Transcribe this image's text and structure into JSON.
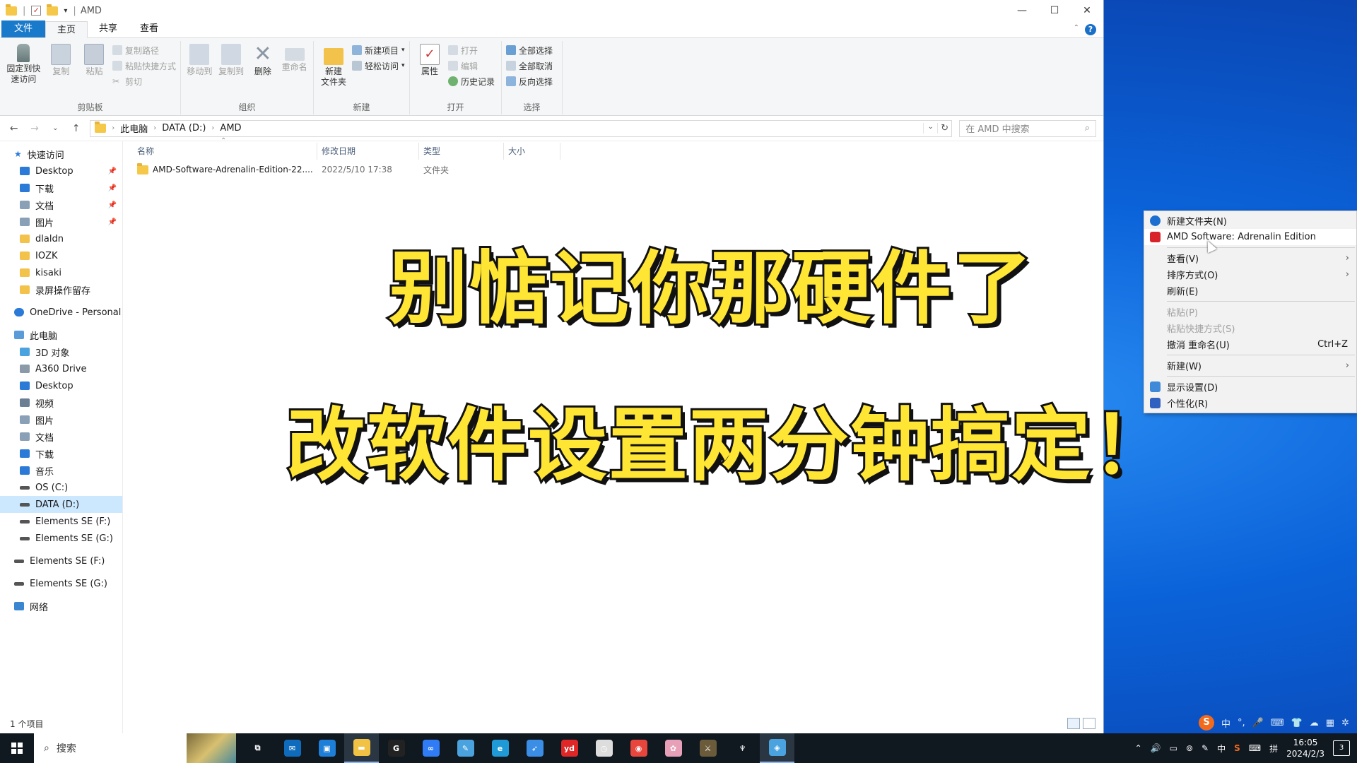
{
  "window": {
    "title": "AMD",
    "controls": {
      "minimize": "—",
      "maximize": "☐",
      "close": "✕"
    }
  },
  "tabs": [
    "文件",
    "主页",
    "共享",
    "查看"
  ],
  "ribbon": {
    "clipboard": {
      "label": "剪贴板",
      "pin": "固定到快\n速访问",
      "copy": "复制",
      "paste": "粘贴",
      "copy_path": "复制路径",
      "paste_shortcut": "粘贴快捷方式",
      "cut": "剪切"
    },
    "organize": {
      "label": "组织",
      "move_to": "移动到",
      "copy_to": "复制到",
      "delete": "删除",
      "rename": "重命名"
    },
    "new": {
      "label": "新建",
      "new_folder": "新建\n文件夹",
      "new_item": "新建项目",
      "easy_access": "轻松访问"
    },
    "open": {
      "label": "打开",
      "properties": "属性",
      "open": "打开",
      "edit": "编辑",
      "history": "历史记录"
    },
    "select": {
      "label": "选择",
      "select_all": "全部选择",
      "select_none": "全部取消",
      "invert": "反向选择"
    }
  },
  "address": {
    "crumbs": [
      "此电脑",
      "DATA (D:)",
      "AMD"
    ],
    "search_placeholder": "在 AMD 中搜索"
  },
  "nav": {
    "quick_access": "快速访问",
    "quick_items": [
      {
        "label": "Desktop",
        "pinned": true
      },
      {
        "label": "下载",
        "pinned": true
      },
      {
        "label": "文档",
        "pinned": true
      },
      {
        "label": "图片",
        "pinned": true
      },
      {
        "label": "dlaldn",
        "pinned": false
      },
      {
        "label": "IOZK",
        "pinned": false
      },
      {
        "label": "kisaki",
        "pinned": false
      },
      {
        "label": "录屏操作留存",
        "pinned": false
      }
    ],
    "onedrive": "OneDrive - Personal",
    "this_pc": "此电脑",
    "pc_items": [
      "3D 对象",
      "A360 Drive",
      "Desktop",
      "视频",
      "图片",
      "文档",
      "下载",
      "音乐",
      "OS (C:)",
      "DATA (D:)",
      "Elements SE (F:)",
      "Elements SE (G:)"
    ],
    "drive_f": "Elements SE (F:)",
    "drive_g": "Elements SE (G:)",
    "network": "网络"
  },
  "columns": [
    "名称",
    "修改日期",
    "类型",
    "大小"
  ],
  "files": [
    {
      "name": "AMD-Software-Adrenalin-Edition-22....",
      "date": "2022/5/10 17:38",
      "type": "文件夹",
      "size": ""
    }
  ],
  "status": {
    "count": "1 个项目"
  },
  "overlay": {
    "line1": "别惦记你那硬件了",
    "line2": "改软件设置两分钟搞定！"
  },
  "context_menu": [
    {
      "label": "新建文件夹(N)",
      "icon": "new-folder-icon",
      "disabled": false
    },
    {
      "label": "AMD Software: Adrenalin Edition",
      "icon": "amd-icon",
      "disabled": false,
      "highlight": true
    },
    {
      "sep": true
    },
    {
      "label": "查看(V)",
      "submenu": true
    },
    {
      "label": "排序方式(O)",
      "submenu": true
    },
    {
      "label": "刷新(E)"
    },
    {
      "sep": true
    },
    {
      "label": "粘贴(P)",
      "disabled": true
    },
    {
      "label": "粘贴快捷方式(S)",
      "disabled": true
    },
    {
      "label": "撤消 重命名(U)",
      "shortcut": "Ctrl+Z"
    },
    {
      "sep": true
    },
    {
      "label": "新建(W)",
      "submenu": true
    },
    {
      "sep": true
    },
    {
      "label": "显示设置(D)",
      "icon": "display-icon"
    },
    {
      "label": "个性化(R)",
      "icon": "personalize-icon"
    }
  ],
  "ime": {
    "lang": "中",
    "punct": "°,"
  },
  "taskbar": {
    "search": "搜索",
    "time": "16:05",
    "date": "2024/2/3",
    "notifications": "3",
    "apps": [
      {
        "name": "task-view-icon",
        "color": "#101820",
        "glyph": "⧉"
      },
      {
        "name": "mail-icon",
        "color": "#0f6cbd",
        "glyph": "✉"
      },
      {
        "name": "store-icon",
        "color": "#1d7fd8",
        "glyph": "▣"
      },
      {
        "name": "explorer-icon",
        "color": "#f1c244",
        "glyph": "▬",
        "active": true
      },
      {
        "name": "g-app-icon",
        "color": "#222",
        "glyph": "G"
      },
      {
        "name": "baidu-netdisk-icon",
        "color": "#2f7cf6",
        "glyph": "∞"
      },
      {
        "name": "notepad-icon",
        "color": "#4aa3df",
        "glyph": "✎"
      },
      {
        "name": "edge-icon",
        "color": "#1f9ad6",
        "glyph": "e"
      },
      {
        "name": "feather-icon",
        "color": "#3a8ee6",
        "glyph": "➶"
      },
      {
        "name": "youdao-icon",
        "color": "#e02727",
        "glyph": "yd"
      },
      {
        "name": "clock-app-icon",
        "color": "#ddd",
        "glyph": "◷"
      },
      {
        "name": "chrome-icon",
        "color": "#e8453c",
        "glyph": "◉"
      },
      {
        "name": "anime-app-icon",
        "color": "#e7a0b8",
        "glyph": "✿"
      },
      {
        "name": "game-app-icon",
        "color": "#6b5b3a",
        "glyph": "⚔"
      },
      {
        "name": "skyrim-icon",
        "color": "#101820",
        "glyph": "♆"
      },
      {
        "name": "screen-recorder-icon",
        "color": "#4aa3df",
        "glyph": "◈",
        "active": true
      }
    ]
  }
}
